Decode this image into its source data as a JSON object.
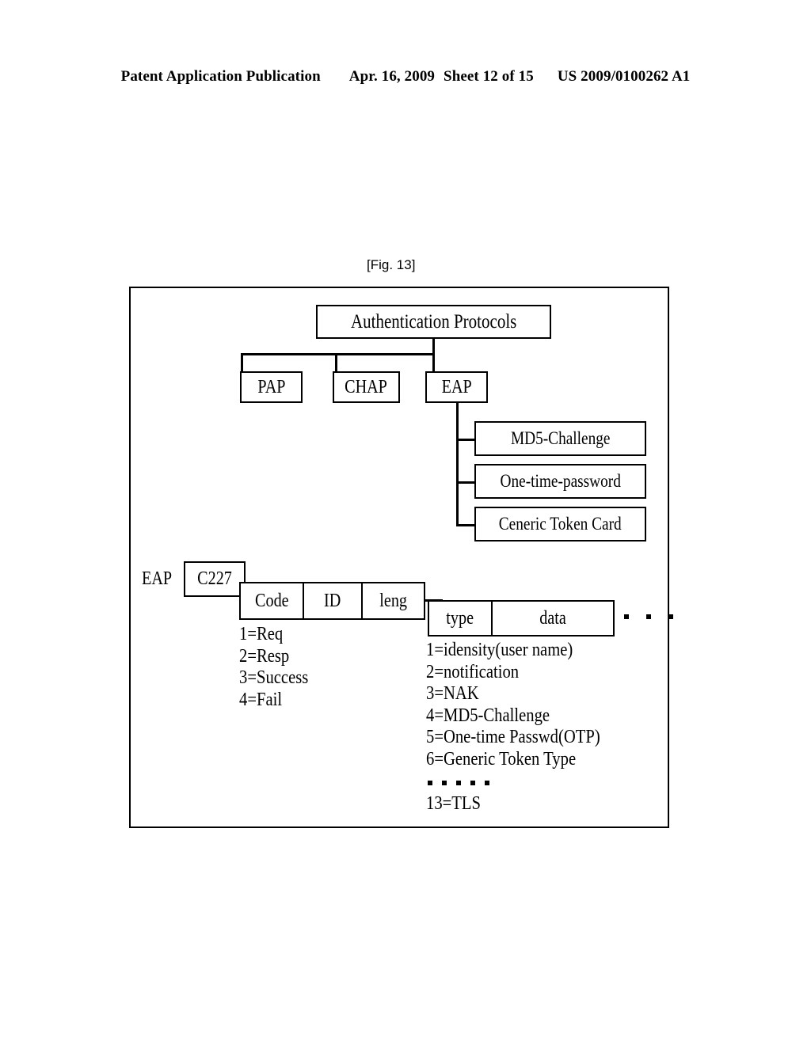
{
  "page_header": {
    "publication": "Patent Application Publication",
    "date": "Apr. 16, 2009",
    "sheet": "Sheet 12 of 15",
    "patent_number": "US 2009/0100262 A1"
  },
  "figure": {
    "caption": "[Fig. 13]",
    "root": {
      "label": "Authentication Protocols"
    },
    "protocols": [
      {
        "label": "PAP"
      },
      {
        "label": "CHAP"
      },
      {
        "label": "EAP"
      }
    ],
    "eap_methods": [
      {
        "label": "MD5-Challenge"
      },
      {
        "label": "One-time-password"
      },
      {
        "label": "Ceneric Token Card"
      }
    ],
    "packet": {
      "protocol_label": "EAP",
      "ethertype": "C227",
      "fields": [
        {
          "label": "Code"
        },
        {
          "label": "ID"
        },
        {
          "label": "leng"
        }
      ],
      "payload_fields": [
        {
          "label": "type"
        },
        {
          "label": "data"
        }
      ],
      "trailing_ellipsis": "· · ·"
    },
    "code_legend": [
      "1=Req",
      "2=Resp",
      "3=Success",
      "4=Fail"
    ],
    "type_legend": [
      "1=idensity(user name)",
      "2=notification",
      "3=NAK",
      "4=MD5-Challenge",
      "5=One-time Passwd(OTP)",
      "6=Generic Token Type"
    ],
    "type_legend_ellipsis": "· · · · ·",
    "type_legend_last": "13=TLS"
  },
  "colors": {
    "ink": "#000000",
    "paper": "#ffffff"
  }
}
